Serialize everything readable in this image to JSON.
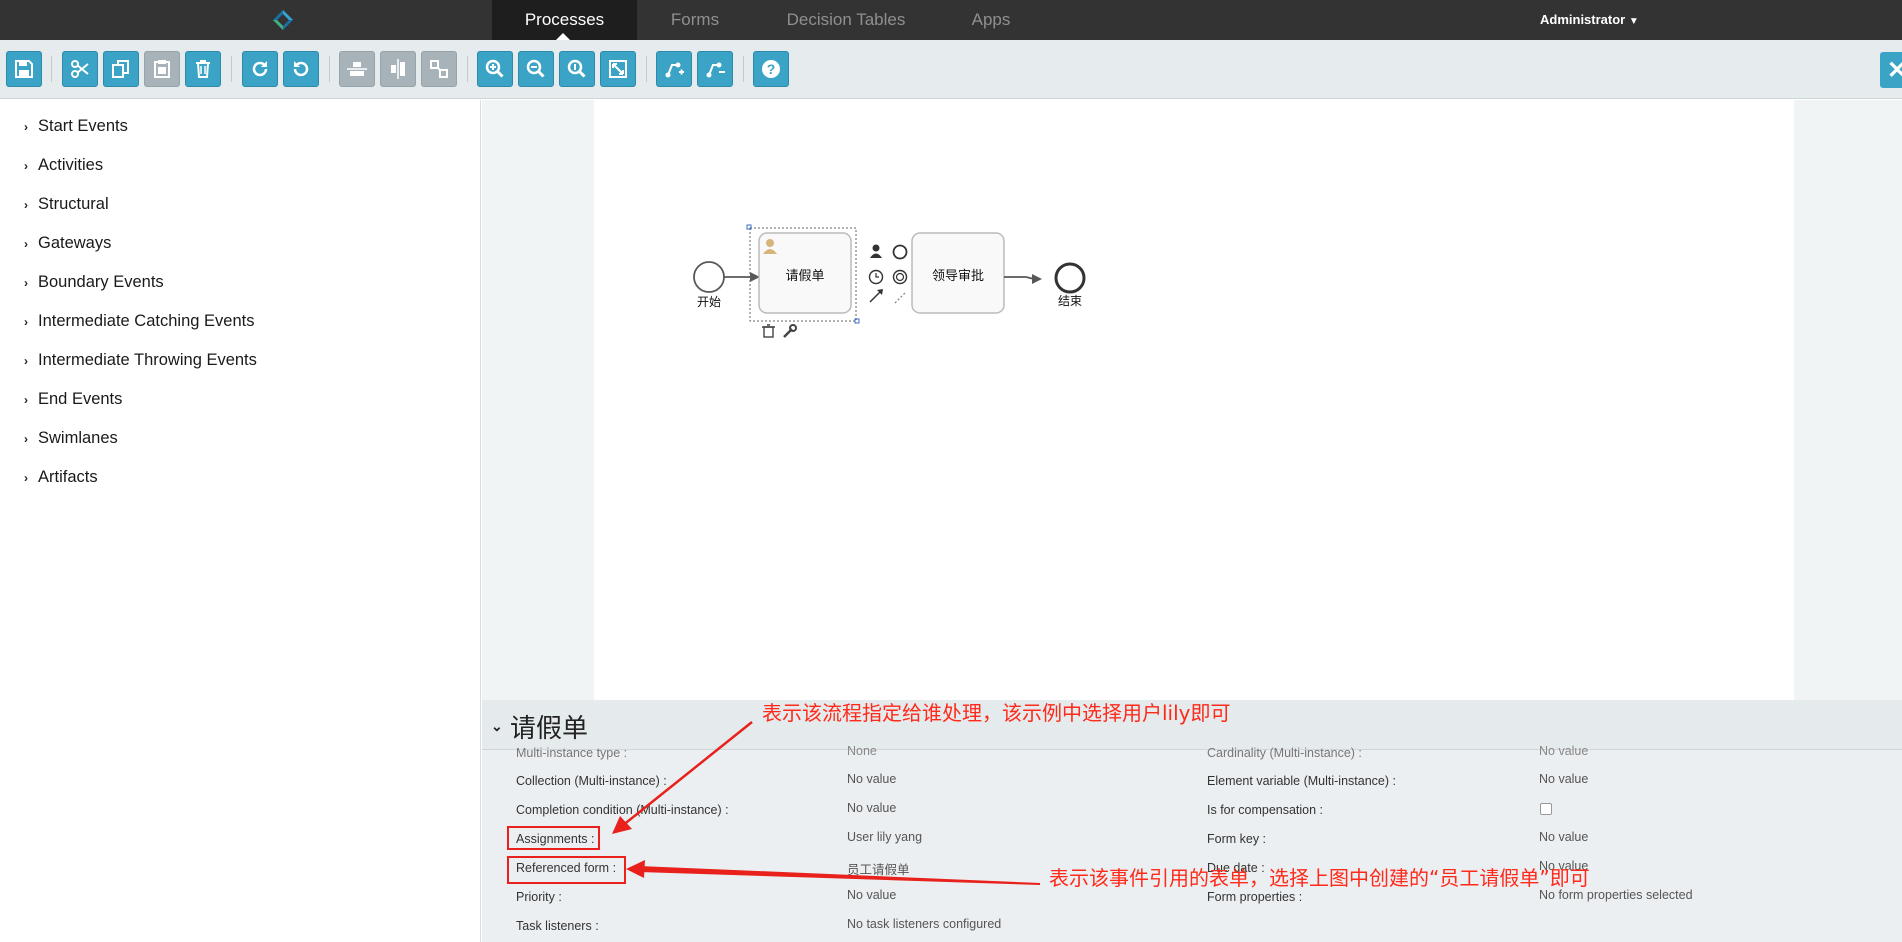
{
  "nav": {
    "tabs": [
      {
        "label": "Processes",
        "active": true
      },
      {
        "label": "Forms",
        "active": false
      },
      {
        "label": "Decision Tables",
        "active": false
      },
      {
        "label": "Apps",
        "active": false
      }
    ],
    "user": "Administrator"
  },
  "toolbar": {
    "buttons": [
      "save-icon",
      "cut-icon",
      "copy-icon",
      "paste-icon",
      "delete-icon",
      "redo-icon",
      "undo-icon",
      "align-horizontal-icon",
      "align-vertical-icon",
      "same-size-icon",
      "zoom-in-icon",
      "zoom-out-icon",
      "zoom-actual-icon",
      "zoom-fit-icon",
      "add-bendpoint-icon",
      "remove-bendpoint-icon",
      "help-icon"
    ],
    "accent": "#3aa3c6",
    "disabled": "#a7b3b8"
  },
  "palette": {
    "items": [
      {
        "label": "Start Events"
      },
      {
        "label": "Activities"
      },
      {
        "label": "Structural"
      },
      {
        "label": "Gateways"
      },
      {
        "label": "Boundary Events"
      },
      {
        "label": "Intermediate Catching Events"
      },
      {
        "label": "Intermediate Throwing Events"
      },
      {
        "label": "End Events"
      },
      {
        "label": "Swimlanes"
      },
      {
        "label": "Artifacts"
      }
    ]
  },
  "diagram": {
    "start_label": "开始",
    "task1_label": "请假单",
    "task2_label": "领导审批",
    "end_label": "结束"
  },
  "properties": {
    "title": "请假单",
    "left": [
      {
        "label": "Multi-instance type :",
        "value": "None"
      },
      {
        "label": "Collection (Multi-instance) :",
        "value": "No value"
      },
      {
        "label": "Completion condition (Multi-instance) :",
        "value": "No value"
      },
      {
        "label": "Assignments :",
        "value": "User lily yang"
      },
      {
        "label": "Referenced form :",
        "value": "员工请假单"
      },
      {
        "label": "Priority :",
        "value": "No value"
      },
      {
        "label": "Task listeners :",
        "value": "No task listeners configured"
      }
    ],
    "right": [
      {
        "label": "Cardinality (Multi-instance) :",
        "value": "No value"
      },
      {
        "label": "Element variable (Multi-instance) :",
        "value": "No value"
      },
      {
        "label": "Is for compensation :",
        "value": ""
      },
      {
        "label": "Form key :",
        "value": "No value"
      },
      {
        "label": "Due date :",
        "value": "No value"
      },
      {
        "label": "Form properties :",
        "value": "No form properties selected"
      }
    ]
  },
  "annotations": {
    "assignments_note": "表示该流程指定给谁处理，该示例中选择用户lily即可",
    "form_note": "表示该事件引用的表单，选择上图中创建的“员工请假单”即可",
    "color": "#ff2a1a"
  }
}
